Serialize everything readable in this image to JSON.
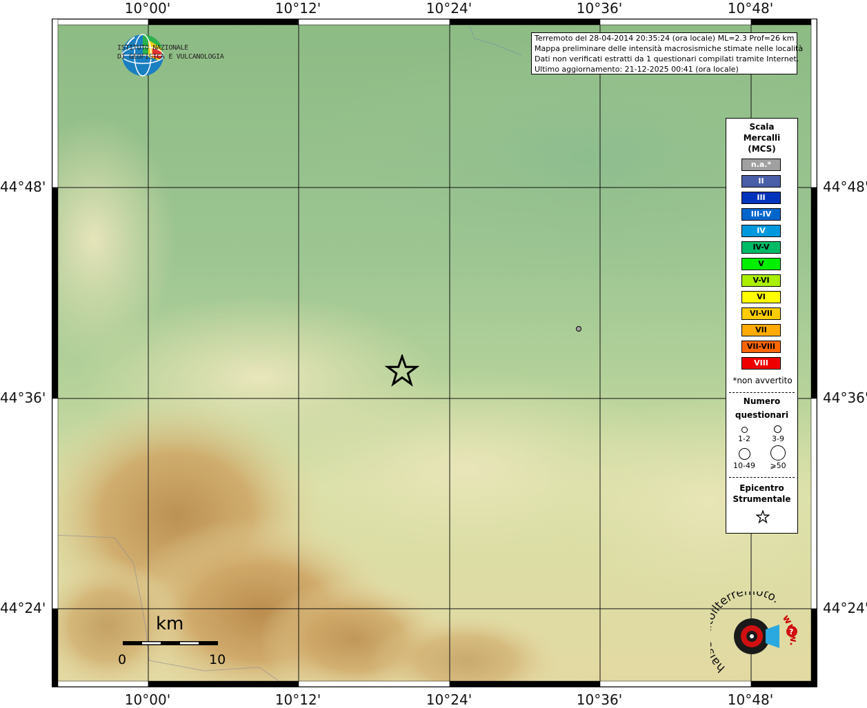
{
  "map": {
    "lon_ticks": [
      "10°00'",
      "10°12'",
      "10°24'",
      "10°36'",
      "10°48'"
    ],
    "lat_ticks": [
      "44°48'",
      "44°36'",
      "44°24'"
    ],
    "epicenter": {
      "lat": 44.625,
      "lon": 10.338
    },
    "questionnaire_point": {
      "lat": 44.665,
      "lon": 10.572,
      "mcs": "n.a.*",
      "count": "1-2"
    }
  },
  "info": {
    "line1": "Terremoto del 28-04-2014 20:35:24 (ora locale) ML=2.3 Prof=26 km",
    "line2": "Mappa preliminare delle intensità macrosismiche stimate nelle località",
    "line3": "Dati non verificati estratti da 1 questionari compilati tramite Internet.",
    "line4": "Ultimo aggiornamento: 21-12-2025 00:41 (ora locale)"
  },
  "ingv": {
    "line1": "ISTITUTO NAZIONALE",
    "line2": "DI GEOFISICA E VULCANOLOGIA"
  },
  "legend": {
    "title1": "Scala",
    "title2": "Mercalli",
    "title3": "(MCS)",
    "scale": [
      {
        "label": "n.a.*",
        "bg": "#a0a0a0",
        "fg": "#ffffff"
      },
      {
        "label": "II",
        "bg": "#4a5fa8",
        "fg": "#ffffff"
      },
      {
        "label": "III",
        "bg": "#0033bb",
        "fg": "#ffffff"
      },
      {
        "label": "III-IV",
        "bg": "#0066cc",
        "fg": "#ffffff"
      },
      {
        "label": "IV",
        "bg": "#0099dd",
        "fg": "#ffffff"
      },
      {
        "label": "IV-V",
        "bg": "#00bb66",
        "fg": "#000000"
      },
      {
        "label": "V",
        "bg": "#00ee00",
        "fg": "#000000"
      },
      {
        "label": "V-VI",
        "bg": "#aaee00",
        "fg": "#000000"
      },
      {
        "label": "VI",
        "bg": "#ffff00",
        "fg": "#000000"
      },
      {
        "label": "VI-VII",
        "bg": "#ffcc00",
        "fg": "#000000"
      },
      {
        "label": "VII",
        "bg": "#ffaa00",
        "fg": "#000000"
      },
      {
        "label": "VII-VIII",
        "bg": "#ff6600",
        "fg": "#000000"
      },
      {
        "label": "VIII",
        "bg": "#ee0000",
        "fg": "#ffffff"
      }
    ],
    "not_felt": "*non avvertito",
    "num_title1": "Numero",
    "num_title2": "questionari",
    "counts": [
      "1-2",
      "3-9",
      "10-49",
      "⩾50"
    ],
    "epi_title1": "Epicentro",
    "epi_title2": "Strumentale"
  },
  "scalebar": {
    "unit": "km",
    "min": "0",
    "max": "10"
  },
  "hsit": {
    "text": "haisentitoilterremoto.it",
    "url": "www."
  }
}
